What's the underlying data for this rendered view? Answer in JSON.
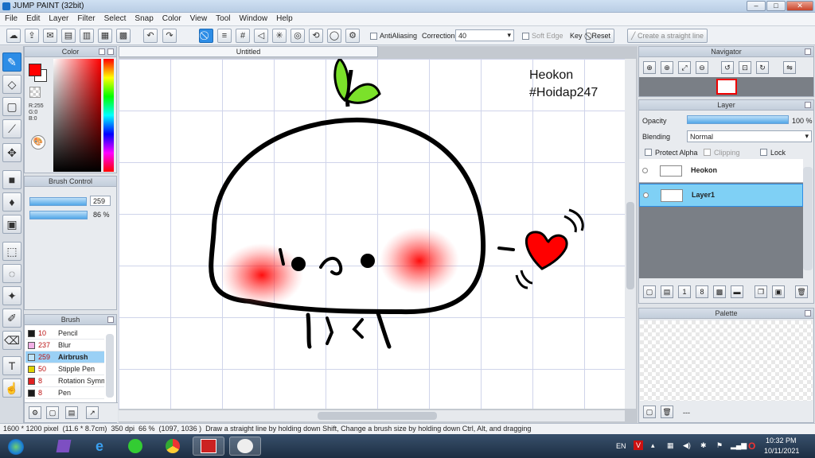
{
  "window": {
    "title": "JUMP PAINT (32bit)",
    "controls": [
      "–",
      "□",
      "✕"
    ]
  },
  "menu": [
    "File",
    "Edit",
    "Layer",
    "Filter",
    "Select",
    "Snap",
    "Color",
    "View",
    "Tool",
    "Window",
    "Help"
  ],
  "toolbar": {
    "antialiasing_label": "AntiAliasing",
    "correction_label": "Correction",
    "correction_value": "40",
    "soft_edge_label": "Soft Edge",
    "key_label": "Key",
    "reset_label": "Reset",
    "straight_line_label": "Create a straight line"
  },
  "color_panel": {
    "title": "Color",
    "rgb": {
      "r": "R:255",
      "g": "G:0",
      "b": "B:0"
    },
    "fg_color": "#ff0000",
    "bg_color": "#ffffff"
  },
  "brush_control": {
    "title": "Brush Control",
    "size_value": "259",
    "opacity_value": "86 %",
    "size_fraction": 0.84,
    "opacity_fraction": 0.86
  },
  "brush_list": {
    "title": "Brush",
    "items": [
      {
        "size": "10",
        "name": "Pencil",
        "color": "#1a1a1a"
      },
      {
        "size": "237",
        "name": "Blur",
        "color": "#f3b0e6"
      },
      {
        "size": "259",
        "name": "Airbrush",
        "color": "#bfe3f8",
        "selected": true
      },
      {
        "size": "50",
        "name": "Stipple Pen",
        "color": "#e0d400"
      },
      {
        "size": "8",
        "name": "Rotation Symm",
        "color": "#e02020"
      },
      {
        "size": "8",
        "name": "Pen",
        "color": "#1a1a1a"
      }
    ]
  },
  "document": {
    "tab_label": "Untitled",
    "signature_line1": "Heokon",
    "signature_line2": "#Hoidap247"
  },
  "navigator": {
    "title": "Navigator"
  },
  "layer_panel": {
    "title": "Layer",
    "opacity_label": "Opacity",
    "opacity_value": "100 %",
    "opacity_fraction": 1.0,
    "blending_label": "Blending",
    "blending_value": "Normal",
    "protect_alpha_label": "Protect Alpha",
    "clipping_label": "Clipping",
    "lock_label": "Lock",
    "layers": [
      {
        "name": "Heokon",
        "selected": false
      },
      {
        "name": "Layer1",
        "selected": true
      }
    ]
  },
  "palette": {
    "title": "Palette",
    "footer_text": "---"
  },
  "status_bar": {
    "size": "1600 * 1200 pixel",
    "dimensions": "(11.6 * 8.7cm)",
    "dpi": "350 dpi",
    "zoom": "66 %",
    "coords": "(1097, 1036 )",
    "hint": "Draw a straight line by holding down Shift, Change a brush size by holding down Ctrl, Alt, and dragging"
  },
  "taskbar": {
    "lang": "EN",
    "time": "10:32 PM",
    "date": "10/11/2021"
  },
  "colors": {
    "accent": "#2d8de6",
    "selected_row": "#9ad0f5",
    "layer_selected": "#7fd0f5"
  }
}
